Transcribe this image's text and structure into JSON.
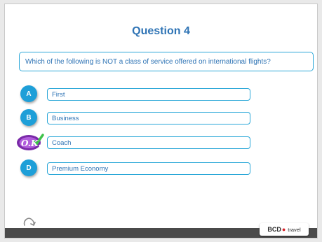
{
  "slide": {
    "title": "Question 4",
    "question": "Which of the following is NOT a class of service offered on international flights?"
  },
  "options": [
    {
      "letter": "A",
      "label": "First"
    },
    {
      "letter": "B",
      "label": "Business"
    },
    {
      "letter": "C",
      "label": "Coach",
      "badge": "O.K."
    },
    {
      "letter": "D",
      "label": "Premium Economy"
    }
  ],
  "footer": {
    "logo_brand": "BCD",
    "logo_suffix": "travel"
  },
  "colors": {
    "accent": "#2aa7d8",
    "text": "#2f74b5",
    "circle": "#1e9fd8",
    "footer": "#4a4a4a"
  },
  "icons": {
    "replay": "replay-icon",
    "ok_badge": "ok-badge-icon"
  }
}
